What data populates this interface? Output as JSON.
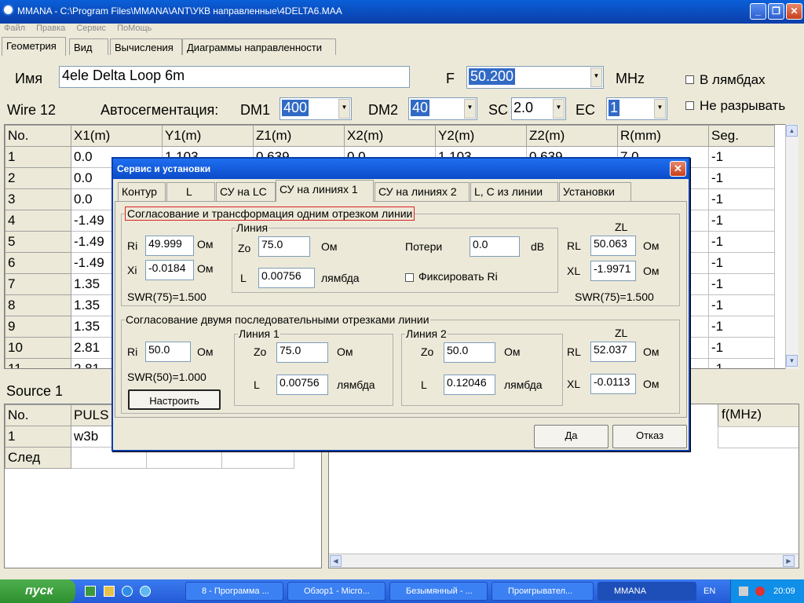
{
  "window": {
    "title": "MMANA - C:\\Program Files\\MMANA\\ANT\\УКВ направленные\\4DELTA6.MAA"
  },
  "menu": [
    "Файл",
    "Правка",
    "Сервис",
    "ПоМощь"
  ],
  "tabs": [
    "Геометрия",
    "Вид",
    "Вычисления",
    "Диаграммы направленности"
  ],
  "geometry": {
    "name_label": "Имя",
    "name_value": "4ele Delta Loop 6m",
    "f_label": "F",
    "f_value": "50.200",
    "f_unit": "MHz",
    "lambda_label": "В лямбдах",
    "nobreak_label": "Не разрывать",
    "wire_label": "Wire 12",
    "autoseg_label": "Автосегментация:",
    "dm1_label": "DM1",
    "dm1_value": "400",
    "dm2_label": "DM2",
    "dm2_value": "40",
    "sc_label": "SC",
    "sc_value": "2.0",
    "ec_label": "EC",
    "ec_value": "1"
  },
  "wire_table": {
    "headers": [
      "No.",
      "X1(m)",
      "Y1(m)",
      "Z1(m)",
      "X2(m)",
      "Y2(m)",
      "Z2(m)",
      "R(mm)",
      "Seg."
    ],
    "rows": [
      [
        "1",
        "0.0",
        "1.103",
        "0.639",
        "0.0",
        "1.103",
        "0.639",
        "7.0",
        "-1"
      ],
      [
        "2",
        "0.0",
        "",
        "",
        "",
        "",
        "",
        "",
        "-1"
      ],
      [
        "3",
        "0.0",
        "",
        "",
        "",
        "",
        "",
        "",
        "-1"
      ],
      [
        "4",
        "-1.49",
        "",
        "",
        "",
        "",
        "",
        "",
        "-1"
      ],
      [
        "5",
        "-1.49",
        "",
        "",
        "",
        "",
        "",
        "",
        "-1"
      ],
      [
        "6",
        "-1.49",
        "",
        "",
        "",
        "",
        "",
        "",
        "-1"
      ],
      [
        "7",
        "1.35",
        "",
        "",
        "",
        "",
        "",
        "",
        "-1"
      ],
      [
        "8",
        "1.35",
        "",
        "",
        "",
        "",
        "",
        "",
        "-1"
      ],
      [
        "9",
        "1.35",
        "",
        "",
        "",
        "",
        "",
        "",
        "-1"
      ],
      [
        "10",
        "2.81",
        "",
        "",
        "",
        "",
        "",
        "",
        "-1"
      ],
      [
        "11",
        "2.81",
        "",
        "",
        "",
        "",
        "",
        "",
        "-1"
      ]
    ]
  },
  "source": {
    "label": "Source 1",
    "headers": [
      "No.",
      "PULS"
    ],
    "rows": [
      [
        "1",
        "w3b"
      ]
    ],
    "next_label": "След",
    "right_header": "f(MHz)"
  },
  "dialog": {
    "title": "Сервис и установки",
    "tabs": [
      "Контур",
      "L",
      "СУ на LC",
      "СУ на линиях 1",
      "СУ на линиях 2",
      "L, C из линии",
      "Установки"
    ],
    "g1": {
      "caption": "Согласование и  трансформация одним отрезком линии",
      "ri_label": "Ri",
      "ri_value": "49.999",
      "xi_label": "Xi",
      "xi_value": "-0.0184",
      "ohm": "Ом",
      "swr_left": "SWR(75)=1.500",
      "line_caption": "Линия",
      "zo_label": "Zo",
      "zo_value": "75.0",
      "l_label": "L",
      "l_value": "0.00756",
      "lambda": "лямбда",
      "loss_label": "Потери",
      "loss_value": "0.0",
      "db": "dB",
      "fix_label": "Фиксировать Ri",
      "zl_label": "ZL",
      "rl_label": "RL",
      "rl_value": "50.063",
      "xl_label": "XL",
      "xl_value": "-1.9971",
      "swr_right": "SWR(75)=1.500"
    },
    "g2": {
      "caption": "Согласование двумя последовательными отрезками линии",
      "ri_label": "Ri",
      "ri_value": "50.0",
      "ohm": "Ом",
      "swr": "SWR(50)=1.000",
      "tune_button": "Настроить",
      "line1_caption": "Линия 1",
      "zo1_label": "Zo",
      "zo1_value": "75.0",
      "l1_label": "L",
      "l1_value": "0.00756",
      "lambda": "лямбда",
      "line2_caption": "Линия 2",
      "zo2_label": "Zo",
      "zo2_value": "50.0",
      "l2_label": "L",
      "l2_value": "0.12046",
      "zl_label": "ZL",
      "rl_label": "RL",
      "rl_value": "52.037",
      "xl_label": "XL",
      "xl_value": "-0.0113"
    },
    "ok_label": "Да",
    "cancel_label": "Отказ"
  },
  "taskbar": {
    "start": "пуск",
    "items": [
      "8 - Программа ...",
      "Обзор1 - Micro...",
      "Безымянный - ...",
      "Проигрывател...",
      "MMANA"
    ],
    "lang": "EN",
    "time": "20:09"
  }
}
